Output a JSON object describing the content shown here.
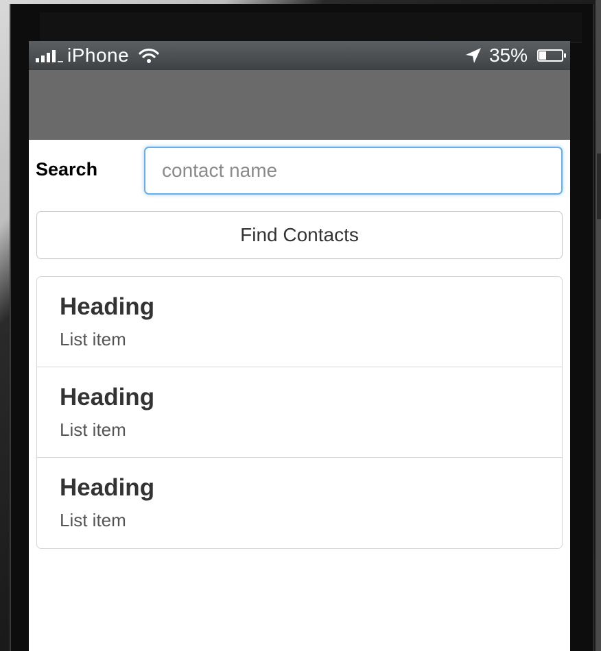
{
  "status_bar": {
    "carrier": "iPhone",
    "battery": "35%",
    "battery_level": 0.35,
    "icons": [
      "signal-icon",
      "wifi-icon",
      "location-arrow-icon",
      "battery-icon"
    ]
  },
  "search": {
    "label": "Search",
    "placeholder": "contact name",
    "value": ""
  },
  "find_button": {
    "label": "Find Contacts"
  },
  "list": {
    "items": [
      {
        "heading": "Heading",
        "text": "List item"
      },
      {
        "heading": "Heading",
        "text": "List item"
      },
      {
        "heading": "Heading",
        "text": "List item"
      }
    ]
  },
  "colors": {
    "header_bg": "#6a6a6a",
    "input_focus_border": "#66afe9",
    "status_bar_bg": "#4a4d50"
  }
}
